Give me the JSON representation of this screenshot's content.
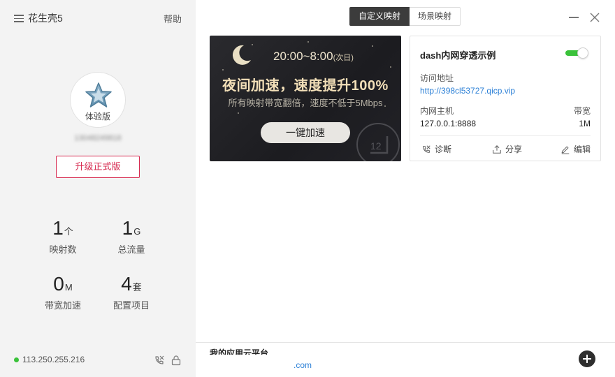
{
  "sidebar": {
    "app_name": "花生壳5",
    "help_label": "帮助",
    "avatar_label": "体验版",
    "user_id": "13048249818",
    "upgrade_label": "升级正式版",
    "stats": [
      {
        "value": "1",
        "unit": "个",
        "label": "映射数"
      },
      {
        "value": "1",
        "unit": "G",
        "label": "总流量"
      },
      {
        "value": "0",
        "unit": "M",
        "label": "带宽加速"
      },
      {
        "value": "4",
        "unit": "套",
        "label": "配置项目"
      }
    ],
    "ip": "113.250.255.216",
    "status_color": "#3ac23a"
  },
  "tabs": [
    {
      "label": "自定义映射",
      "active": true
    },
    {
      "label": "场景映射",
      "active": false
    }
  ],
  "banner": {
    "time": "20:00~8:00",
    "time_note": "(次日)",
    "title": "夜间加速，速度提升100%",
    "subtitle": "所有映射带宽翻倍，速度不低于5Mbps",
    "button": "一键加速",
    "clock_number": "12"
  },
  "mapping": {
    "name": "dash内网穿透示例",
    "enabled": true,
    "access_label": "访问地址",
    "url": "http://398cl53727.qicp.vip",
    "host_label": "内网主机",
    "host": "127.0.0.1:8888",
    "bandwidth_label": "带宽",
    "bandwidth": "1M",
    "actions": {
      "diagnose": "诊断",
      "share": "分享",
      "edit": "编辑"
    }
  },
  "bottom": {
    "title": "我的应用云平台",
    "link": ".com"
  },
  "colors": {
    "accent": "#d6284e",
    "link": "#2a7fd6",
    "toggle_on": "#3ac23a",
    "banner_text": "#f2dfb8"
  }
}
